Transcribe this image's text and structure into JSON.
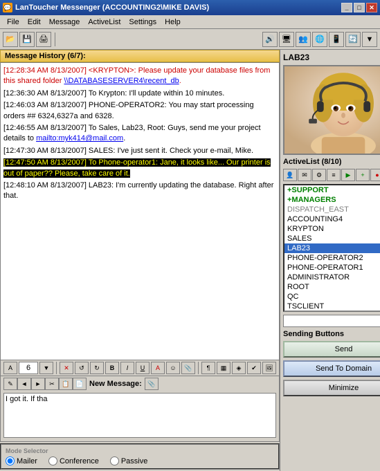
{
  "titleBar": {
    "title": "LanToucher Messenger (ACCOUNTING2\\MIKE DAVIS)",
    "icon": "💬",
    "btnMinimize": "_",
    "btnMaximize": "□",
    "btnClose": "✕"
  },
  "menuBar": {
    "items": [
      "File",
      "Edit",
      "Message",
      "ActiveList",
      "Settings",
      "Help"
    ]
  },
  "toolbar": {
    "buttons": [
      "📁",
      "💾",
      "🖨️"
    ]
  },
  "historyHeader": "Message History (6/7):",
  "messages": [
    {
      "id": 1,
      "style": "red",
      "text": "[12:28:34 AM 8/13/2007] <KRYPTON>: Please update your database files from this shared folder \\\\DATABASESERVER4\\recent_db."
    },
    {
      "id": 2,
      "style": "black",
      "text": "[12:36:30 AM 8/13/2007] To Krypton: I'll update within 10 minutes."
    },
    {
      "id": 3,
      "style": "black",
      "text": "[12:46:03 AM 8/13/2007] PHONE-OPERATOR2: You may start processing orders ## 6324,6327a and 6328."
    },
    {
      "id": 4,
      "style": "black",
      "text": "[12:46:55 AM 8/13/2007] To Sales, Lab23, Root: Guys, send me your project details to mailto:myk414@mail.com."
    },
    {
      "id": 5,
      "style": "black",
      "text": "[12:47:30 AM 8/13/2007] SALES: I've just sent it. Check your e-mail, Mike."
    },
    {
      "id": 6,
      "style": "highlight",
      "text": "[12:47:50 AM 8/13/2007] To Phone-operator1: Jane, it looks like... Our printer is out of paper?? Please, take care of it."
    },
    {
      "id": 7,
      "style": "black",
      "text": "[12:48:10 AM 8/13/2007] LAB23: I'm currently updating the database. Right after that."
    }
  ],
  "inputToolbar": {
    "fontSize": "6",
    "buttons": [
      "✕",
      "↺",
      "↻",
      "🔤",
      "▶",
      "◀",
      "📋",
      "🖊️",
      "📎"
    ]
  },
  "newMessage": {
    "label": "New Message:",
    "value": "I got it. If tha",
    "placeholder": ""
  },
  "modeSelector": {
    "label": "Mode Selector",
    "options": [
      "Mailer",
      "Conference",
      "Passive"
    ],
    "selected": "Mailer"
  },
  "rightPanel": {
    "userLabel": "LAB23",
    "activeListHeader": "ActiveList (8/10)",
    "activeListItems": [
      {
        "name": "+SUPPORT",
        "style": "green"
      },
      {
        "name": "+MANAGERS",
        "style": "green"
      },
      {
        "name": "DISPATCH_EAST",
        "style": "gray"
      },
      {
        "name": "ACCOUNTING4",
        "style": "normal"
      },
      {
        "name": "KRYPTON",
        "style": "normal"
      },
      {
        "name": "SALES",
        "style": "normal"
      },
      {
        "name": "LAB23",
        "style": "selected"
      },
      {
        "name": "PHONE-OPERATOR2",
        "style": "normal"
      },
      {
        "name": "PHONE-OPERATOR1",
        "style": "normal"
      },
      {
        "name": "ADMINISTRATOR",
        "style": "normal"
      },
      {
        "name": "ROOT",
        "style": "normal"
      },
      {
        "name": "QC",
        "style": "normal"
      },
      {
        "name": "TSCLIENT",
        "style": "normal"
      }
    ],
    "searchPlaceholder": "",
    "sendingButtonsLabel": "Sending Buttons",
    "sendLabel": "Send",
    "sendToDomainLabel": "Send To Domain",
    "minimizeLabel": "Minimize"
  }
}
